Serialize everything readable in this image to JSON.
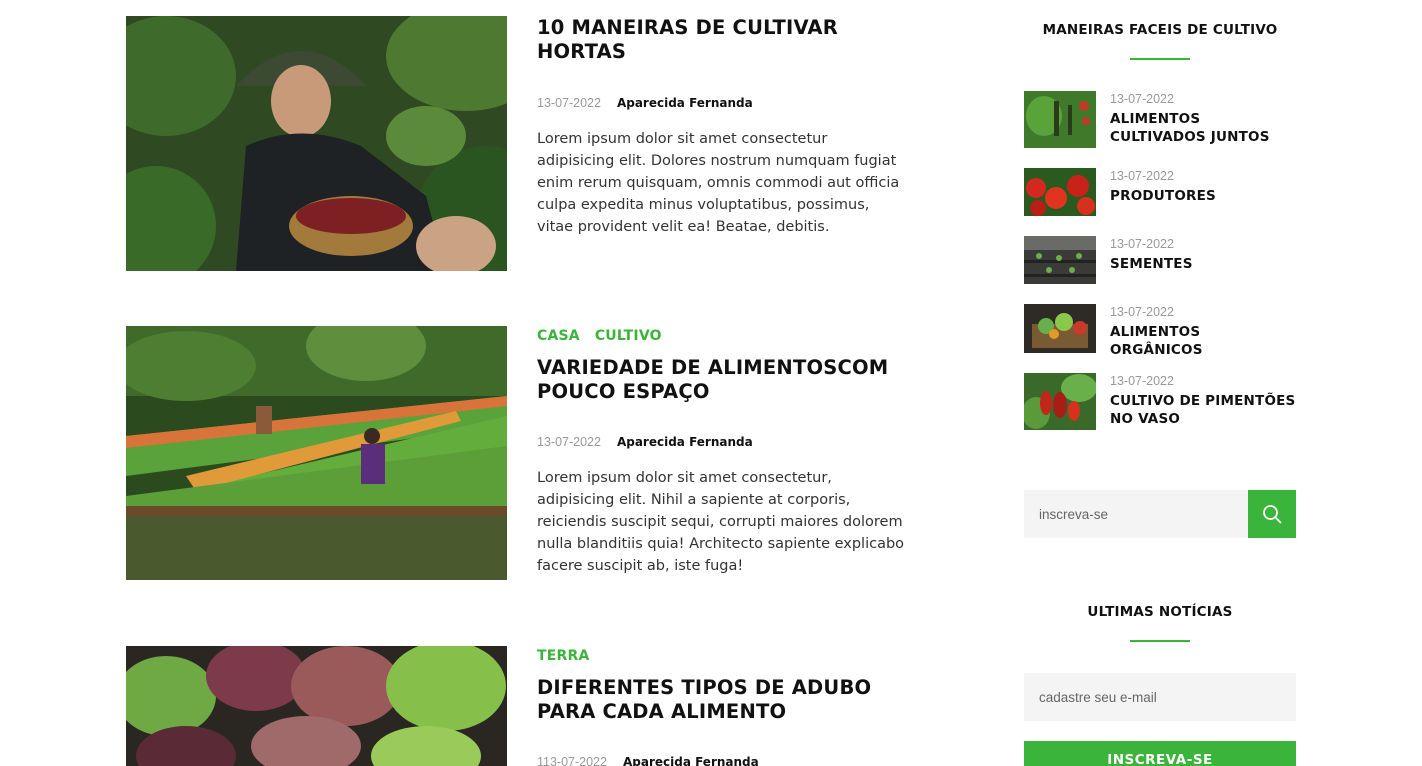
{
  "posts": [
    {
      "tags": [],
      "title": "10 MANEIRAS DE CULTIVAR HORTAS",
      "date": "13-07-2022",
      "author": "Aparecida Fernanda",
      "excerpt": "Lorem ipsum dolor sit amet consectetur adipisicing elit. Dolores nostrum numquam fugiat enim rerum quisquam, omnis commodi aut officia culpa expedita minus voluptatibus, possimus, vitae provident velit ea! Beatae, debitis."
    },
    {
      "tags": [
        "CASA",
        "CULTIVO"
      ],
      "title": "VARIEDADE DE ALIMENTOSCOM POUCO ESPAÇO",
      "date": "13-07-2022",
      "author": "Aparecida Fernanda",
      "excerpt": "Lorem ipsum dolor sit amet consectetur, adipisicing elit. Nihil a sapiente at corporis, reiciendis suscipit sequi, corrupti maiores dolorem nulla blanditiis quia! Architecto sapiente explicabo facere suscipit ab, iste fuga!"
    },
    {
      "tags": [
        "TERRA"
      ],
      "title": "DIFERENTES TIPOS DE ADUBO PARA CADA ALIMENTO",
      "date": "113-07-2022",
      "author": "Aparecida Fernanda",
      "excerpt": ""
    }
  ],
  "sidebar": {
    "widget_title": "MANEIRAS FACEIS DE CULTIVO",
    "items": [
      {
        "date": "13-07-2022",
        "title": "ALIMENTOS CULTIVADOS JUNTOS"
      },
      {
        "date": "13-07-2022",
        "title": "PRODUTORES"
      },
      {
        "date": "13-07-2022",
        "title": "SEMENTES"
      },
      {
        "date": "13-07-2022",
        "title": "ALIMENTOS ORGÂNICOS"
      },
      {
        "date": "13-07-2022",
        "title": "CULTIVO DE PIMENTÕES NO VASO"
      }
    ],
    "search_placeholder": "inscreva-se",
    "news_title": "ULTIMAS NOTÍCIAS",
    "email_placeholder": "cadastre seu e-mail",
    "subscribe_label": "INSCREVA-SE"
  },
  "colors": {
    "accent": "#3bb43b",
    "field_bg": "#f3f4f3"
  },
  "icons": {
    "search": "search-icon"
  }
}
